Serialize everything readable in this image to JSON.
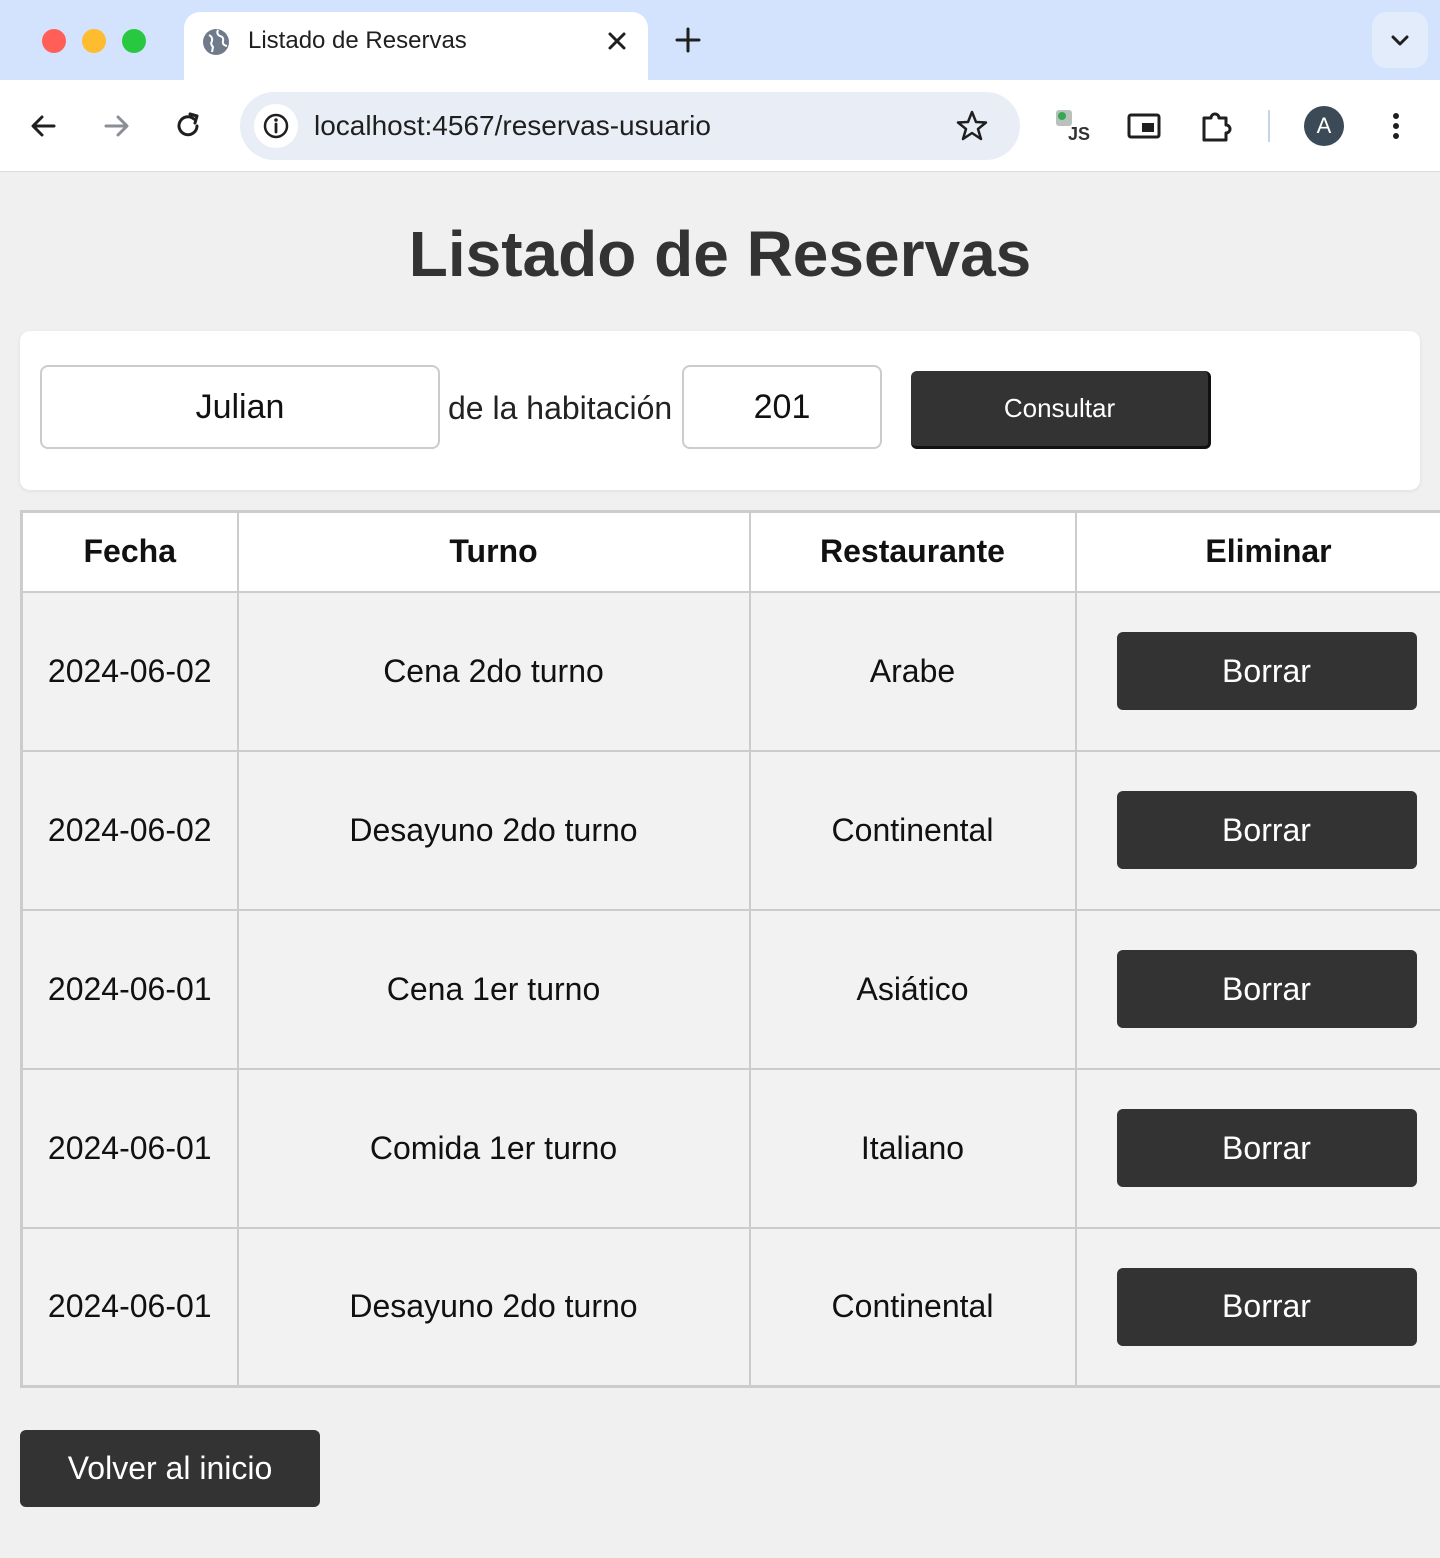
{
  "browser": {
    "tab_title": "Listado de Reservas",
    "url_host": "localhost",
    "url_rest": ":4567/reservas-usuario",
    "avatar_letter": "A",
    "icons": [
      "globe-icon",
      "close-icon",
      "plus-icon",
      "chevron-down-icon",
      "back-arrow-icon",
      "forward-arrow-icon",
      "reload-icon",
      "info-icon",
      "star-icon",
      "js-extension-icon",
      "picture-in-picture-icon",
      "puzzle-icon",
      "kebab-menu-icon"
    ]
  },
  "page": {
    "title": "Listado de Reservas"
  },
  "query": {
    "name_value": "Julian",
    "room_label": "de la habitación",
    "room_value": "201",
    "submit_label": "Consultar"
  },
  "table": {
    "headers": [
      "Fecha",
      "Turno",
      "Restaurante",
      "Eliminar"
    ],
    "rows": [
      {
        "fecha": "2024-06-02",
        "turno": "Cena 2do turno",
        "restaurante": "Arabe",
        "action": "Borrar"
      },
      {
        "fecha": "2024-06-02",
        "turno": "Desayuno 2do turno",
        "restaurante": "Continental",
        "action": "Borrar"
      },
      {
        "fecha": "2024-06-01",
        "turno": "Cena 1er turno",
        "restaurante": "Asiático",
        "action": "Borrar"
      },
      {
        "fecha": "2024-06-01",
        "turno": "Comida 1er turno",
        "restaurante": "Italiano",
        "action": "Borrar"
      },
      {
        "fecha": "2024-06-01",
        "turno": "Desayuno 2do turno",
        "restaurante": "Continental",
        "action": "Borrar"
      }
    ]
  },
  "footer": {
    "back_label": "Volver al inicio"
  },
  "colors": {
    "button_bg": "#333333",
    "page_bg": "#f0f0f0",
    "tabstrip_bg": "#d3e3fd"
  }
}
